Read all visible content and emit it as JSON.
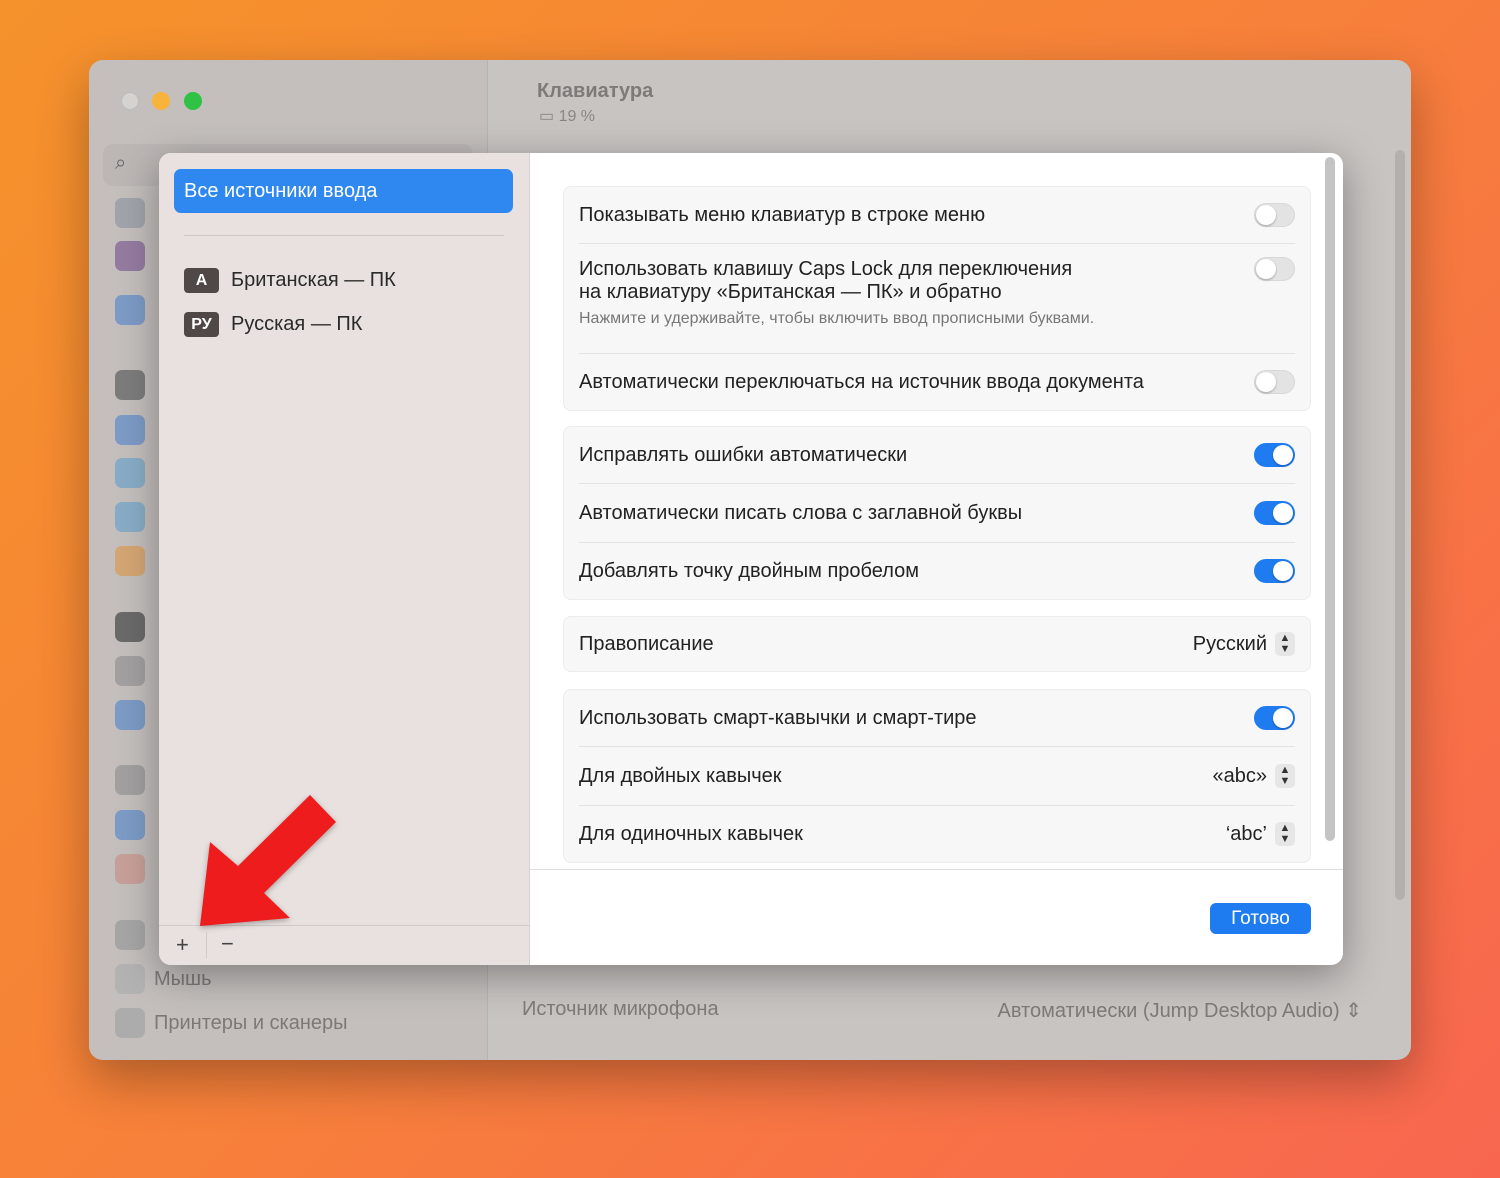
{
  "window": {
    "title": "Клавиатура",
    "battery": "19 %"
  },
  "sidebar": {
    "items": [
      "Мышь",
      "Принтеры и сканеры"
    ]
  },
  "background": {
    "mic_label": "Источник микрофона",
    "mic_value": "Автоматически (Jump Desktop Audio)"
  },
  "sheet": {
    "all_sources": "Все источники ввода",
    "sources": [
      {
        "badge": "A",
        "label": "Британская — ПК"
      },
      {
        "badge": "РУ",
        "label": "Русская — ПК"
      }
    ],
    "add": "+",
    "remove": "−",
    "settings": {
      "show_menu": "Показывать меню клавиатур в строке меню",
      "caps_line1": "Использовать клавишу Caps Lock для переключения",
      "caps_line2": "на клавиатуру «Британская — ПК» и обратно",
      "caps_hint": "Нажмите и удерживайте, чтобы включить ввод прописными буквами.",
      "auto_switch": "Автоматически переключаться на источник ввода документа",
      "autocorrect": "Исправлять ошибки автоматически",
      "capitalize": "Автоматически писать слова с заглавной буквы",
      "double_space": "Добавлять точку двойным пробелом",
      "spelling": "Правописание",
      "spelling_value": "Русский",
      "smart_quotes": "Использовать смарт-кавычки и смарт-тире",
      "double_quotes": "Для двойных кавычек",
      "double_value": "«abc»",
      "single_quotes": "Для одиночных кавычек",
      "single_value": "‘abc’"
    },
    "toggles": {
      "show_menu": false,
      "caps": false,
      "auto_switch": false,
      "autocorrect": true,
      "capitalize": true,
      "double_space": true,
      "smart_quotes": true
    },
    "done": "Готово"
  }
}
